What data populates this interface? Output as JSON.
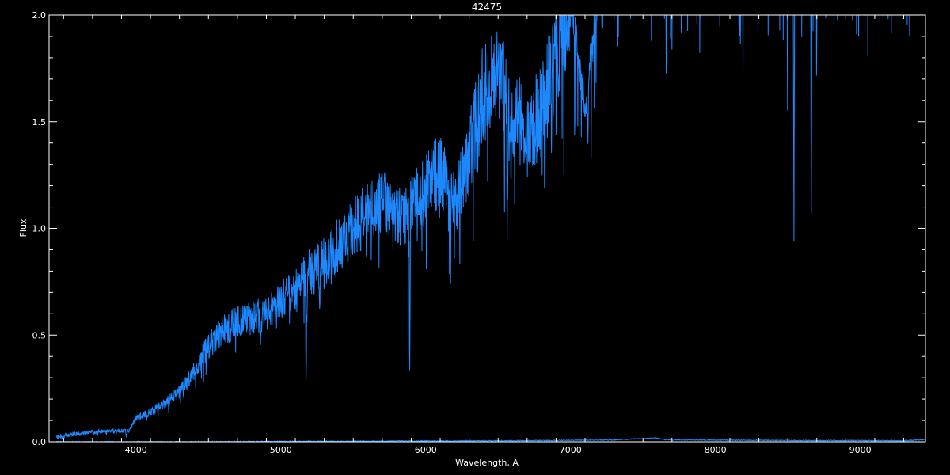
{
  "chart_data": {
    "type": "line",
    "title": "42475",
    "xlabel": "Wavelength, A",
    "ylabel": "Flux",
    "xlim": [
      3400,
      9450
    ],
    "ylim": [
      0.0,
      2.0
    ],
    "x_ticks": [
      4000,
      5000,
      6000,
      7000,
      8000,
      9000
    ],
    "x_tick_labels": [
      "4000",
      "5000",
      "6000",
      "7000",
      "8000",
      "9000"
    ],
    "y_ticks": [
      0.0,
      0.5,
      1.0,
      1.5,
      2.0
    ],
    "y_tick_labels": [
      "0.0",
      "0.5",
      "1.0",
      "1.5",
      "2.0"
    ],
    "grid": false,
    "colors": {
      "background": "#000000",
      "axes": "#ffffff",
      "spectrum": "#1e88ff"
    },
    "series": [
      {
        "x": [
          3450,
          3600,
          3800,
          3950,
          4000,
          4100,
          4200,
          4300,
          4400,
          4500,
          4600,
          4700,
          4800,
          4900,
          5000,
          5100,
          5200,
          5300,
          5400,
          5500,
          5600,
          5700,
          5800,
          5900,
          6000,
          6100,
          6200,
          6300,
          6400,
          6500,
          6600,
          6700,
          6800,
          6900,
          7000,
          7100,
          7200,
          7300,
          7400,
          7500,
          7600,
          7700,
          7800,
          7900,
          8000,
          8100,
          8200,
          8300,
          8400,
          8500,
          8600,
          8700,
          8800,
          8900,
          9000,
          9100,
          9200,
          9300,
          9400
        ],
        "y": [
          0.02,
          0.04,
          0.05,
          0.05,
          0.11,
          0.14,
          0.18,
          0.23,
          0.33,
          0.45,
          0.52,
          0.56,
          0.58,
          0.6,
          0.66,
          0.72,
          0.8,
          0.84,
          0.93,
          1.0,
          1.08,
          1.12,
          1.05,
          1.1,
          1.18,
          1.28,
          1.1,
          1.35,
          1.65,
          1.75,
          1.55,
          1.45,
          1.55,
          1.8,
          2.1,
          1.55,
          2.2,
          2.3,
          2.35,
          2.4,
          2.4,
          2.45,
          2.45,
          2.45,
          2.45,
          2.45,
          2.45,
          2.45,
          2.45,
          2.45,
          2.45,
          2.45,
          2.45,
          2.45,
          2.45,
          2.45,
          2.45,
          2.45,
          2.45
        ]
      },
      {
        "x": [
          3450,
          3700,
          4000,
          4200,
          4600,
          5000,
          5500,
          6000,
          6500,
          7000,
          7300,
          7600,
          7650,
          7700,
          8000,
          8300,
          8600,
          9000,
          9300,
          9450
        ],
        "y": [
          0.0,
          0.0,
          0.0,
          0.0,
          0.001,
          0.002,
          0.003,
          0.004,
          0.005,
          0.007,
          0.009,
          0.018,
          0.01,
          0.009,
          0.008,
          0.007,
          0.006,
          0.006,
          0.005,
          0.01
        ]
      }
    ],
    "absorption_lines": [
      {
        "x": 3934,
        "depth": 0.03
      },
      {
        "x": 4227,
        "depth": 0.08
      },
      {
        "x": 4861,
        "depth": 0.15
      },
      {
        "x": 5175,
        "depth": 0.45
      },
      {
        "x": 5270,
        "depth": 0.25
      },
      {
        "x": 5890,
        "depth": 0.75
      },
      {
        "x": 6563,
        "depth": 0.85
      },
      {
        "x": 6870,
        "depth": 0.35
      },
      {
        "x": 7120,
        "depth": 0.3
      },
      {
        "x": 7660,
        "depth": 0.65
      },
      {
        "x": 7700,
        "depth": 0.55
      },
      {
        "x": 7900,
        "depth": 0.25
      },
      {
        "x": 8190,
        "depth": 0.45
      },
      {
        "x": 8400,
        "depth": 0.4
      },
      {
        "x": 8498,
        "depth": 0.9
      },
      {
        "x": 8542,
        "depth": 1.5
      },
      {
        "x": 8662,
        "depth": 1.45
      },
      {
        "x": 8700,
        "depth": 0.55
      },
      {
        "x": 8806,
        "depth": 0.35
      },
      {
        "x": 9210,
        "depth": 0.2
      }
    ]
  }
}
